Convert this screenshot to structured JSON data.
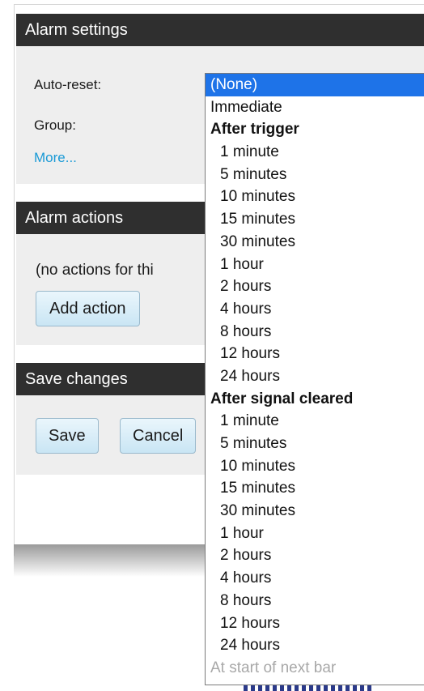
{
  "alarm_settings": {
    "title": "Alarm settings",
    "auto_reset_label": "Auto-reset:",
    "group_label": "Group:",
    "more_link": "More..."
  },
  "alarm_actions": {
    "title": "Alarm actions",
    "empty_text": "(no actions for thi",
    "add_action_button": "Add action"
  },
  "save_changes": {
    "title": "Save changes",
    "save_button": "Save",
    "cancel_button": "Cancel"
  },
  "auto_reset_dropdown": {
    "selected": "(None)",
    "options": [
      {
        "label": "(None)",
        "kind": "option",
        "selected": true
      },
      {
        "label": "Immediate",
        "kind": "option"
      },
      {
        "label": "After trigger",
        "kind": "group"
      },
      {
        "label": "1 minute",
        "kind": "sub"
      },
      {
        "label": "5 minutes",
        "kind": "sub"
      },
      {
        "label": "10 minutes",
        "kind": "sub"
      },
      {
        "label": "15 minutes",
        "kind": "sub"
      },
      {
        "label": "30 minutes",
        "kind": "sub"
      },
      {
        "label": "1 hour",
        "kind": "sub"
      },
      {
        "label": "2 hours",
        "kind": "sub"
      },
      {
        "label": "4 hours",
        "kind": "sub"
      },
      {
        "label": "8 hours",
        "kind": "sub"
      },
      {
        "label": "12 hours",
        "kind": "sub"
      },
      {
        "label": "24 hours",
        "kind": "sub"
      },
      {
        "label": "After signal cleared",
        "kind": "group"
      },
      {
        "label": "1 minute",
        "kind": "sub"
      },
      {
        "label": "5 minutes",
        "kind": "sub"
      },
      {
        "label": "10 minutes",
        "kind": "sub"
      },
      {
        "label": "15 minutes",
        "kind": "sub"
      },
      {
        "label": "30 minutes",
        "kind": "sub"
      },
      {
        "label": "1 hour",
        "kind": "sub"
      },
      {
        "label": "2 hours",
        "kind": "sub"
      },
      {
        "label": "4 hours",
        "kind": "sub"
      },
      {
        "label": "8 hours",
        "kind": "sub"
      },
      {
        "label": "12 hours",
        "kind": "sub"
      },
      {
        "label": "24 hours",
        "kind": "sub"
      },
      {
        "label": "At start of next bar",
        "kind": "disabled"
      }
    ]
  },
  "colors": {
    "header_bg": "#2f2f2f",
    "panel_bg": "#eeeeee",
    "link": "#1a9ad6",
    "selection": "#1e73e8"
  }
}
